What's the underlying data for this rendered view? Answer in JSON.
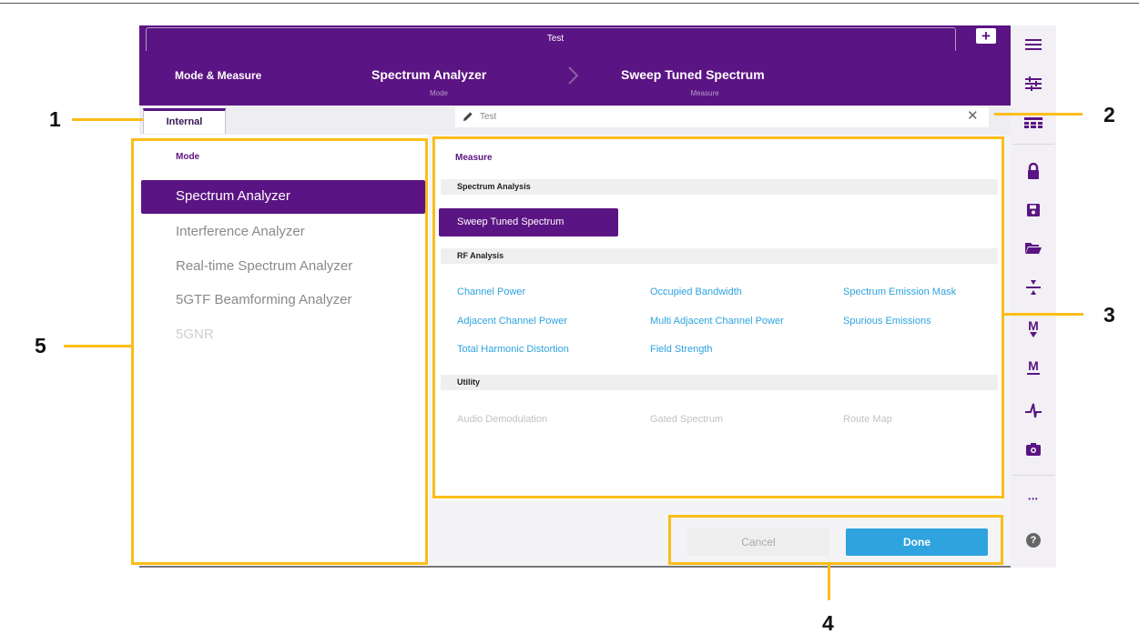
{
  "window": {
    "tab_title": "Test",
    "plus_label": "+"
  },
  "breadcrumb": {
    "root": "Mode & Measure",
    "mode": {
      "value": "Spectrum Analyzer",
      "sub": "Mode"
    },
    "measure": {
      "value": "Sweep Tuned Spectrum",
      "sub": "Measure"
    }
  },
  "tabs": [
    {
      "label": "Internal",
      "selected": true
    }
  ],
  "search": {
    "value": "Test",
    "clear_icon": "close-icon"
  },
  "mode_panel": {
    "header": "Mode",
    "items": [
      {
        "label": "Spectrum Analyzer",
        "selected": true
      },
      {
        "label": "Interference Analyzer"
      },
      {
        "label": "Real-time Spectrum Analyzer"
      },
      {
        "label": "5GTF Beamforming Analyzer"
      },
      {
        "label": "5GNR",
        "disabled": true
      }
    ]
  },
  "measure_panel": {
    "header": "Measure",
    "sections": [
      {
        "title": "Spectrum Analysis",
        "items": [
          "Sweep Tuned Spectrum"
        ]
      },
      {
        "title": "RF Analysis",
        "items": [
          "Channel Power",
          "Occupied Bandwidth",
          "Spectrum Emission Mask",
          "Adjacent Channel Power",
          "Multi Adjacent Channel Power",
          "Spurious Emissions",
          "Total Harmonic Distortion",
          "Field Strength"
        ]
      },
      {
        "title": "Utility",
        "items": [
          "Audio Demodulation",
          "Gated Spectrum",
          "Route Map"
        ]
      }
    ]
  },
  "buttons": {
    "cancel": "Cancel",
    "done": "Done"
  },
  "toolbar": {
    "icons": [
      "menu-icon",
      "sliders-icon",
      "grid-icon",
      "lock-icon",
      "save-icon",
      "folder-open-icon",
      "divide-icon",
      "marker-down-icon",
      "marker-icon",
      "trace-icon",
      "camera-icon",
      "more-icon",
      "help-icon"
    ],
    "more_glyph": "•••",
    "help_glyph": "?"
  },
  "callouts": [
    "1",
    "2",
    "3",
    "4",
    "5"
  ],
  "colors": {
    "brand_purple": "#5b1483",
    "accent_blue": "#2ea3de",
    "callout_yellow": "#fbbd18"
  }
}
